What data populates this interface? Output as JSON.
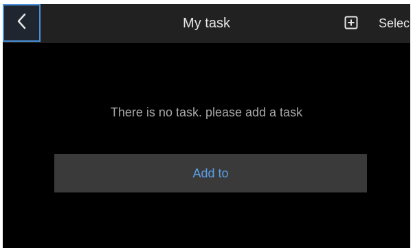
{
  "header": {
    "title": "My task",
    "back_icon": "chevron-left-icon",
    "add_icon": "plus-square-icon",
    "select_label": "Selec"
  },
  "main": {
    "empty_message": "There is no task. please add a task",
    "add_button_label": "Add to"
  },
  "colors": {
    "background": "#000000",
    "header_background": "#212121",
    "accent": "#4a90d9",
    "button_background": "#3a3a3a",
    "button_text": "#5aa0e8",
    "muted_text": "#a8a8a8"
  }
}
